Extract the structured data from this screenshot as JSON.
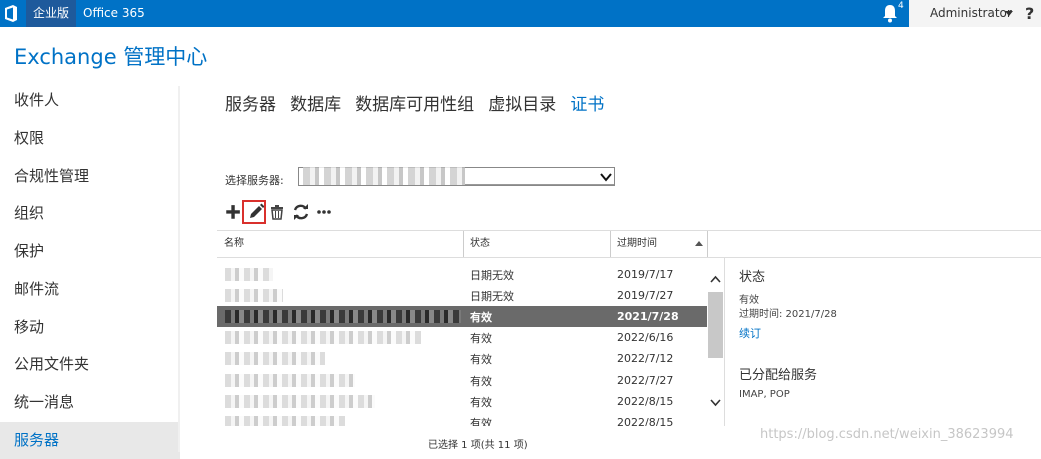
{
  "topbar": {
    "edition_label": "企业版",
    "product_label": "Office 365",
    "notification_count": "4",
    "user": "Administrator",
    "help": "?"
  },
  "app_title": "Exchange 管理中心",
  "sidebar": {
    "items": [
      {
        "label": "收件人"
      },
      {
        "label": "权限"
      },
      {
        "label": "合规性管理"
      },
      {
        "label": "组织"
      },
      {
        "label": "保护"
      },
      {
        "label": "邮件流"
      },
      {
        "label": "移动"
      },
      {
        "label": "公用文件夹"
      },
      {
        "label": "统一消息"
      },
      {
        "label": "服务器",
        "selected": true
      }
    ]
  },
  "tabs": [
    {
      "label": "服务器"
    },
    {
      "label": "数据库"
    },
    {
      "label": "数据库可用性组"
    },
    {
      "label": "虚拟目录"
    },
    {
      "label": "证书",
      "active": true
    }
  ],
  "server_select": {
    "label": "选择服务器:"
  },
  "toolbar": {
    "icons": [
      "add-icon",
      "edit-icon",
      "delete-icon",
      "refresh-icon",
      "more-icon"
    ]
  },
  "grid": {
    "columns": [
      "名称",
      "状态",
      "过期时间"
    ],
    "sorted_column": "过期时间",
    "rows": [
      {
        "status": "日期无效",
        "expires": "2019/7/17"
      },
      {
        "status": "日期无效",
        "expires": "2019/7/27"
      },
      {
        "status": "有效",
        "expires": "2021/7/28",
        "selected": true
      },
      {
        "status": "有效",
        "expires": "2022/6/16"
      },
      {
        "status": "有效",
        "expires": "2022/7/12"
      },
      {
        "status": "有效",
        "expires": "2022/7/27"
      },
      {
        "status": "有效",
        "expires": "2022/8/15"
      },
      {
        "status": "有效",
        "expires": "2022/8/15"
      }
    ]
  },
  "details": {
    "status_heading": "状态",
    "status_value": "有效",
    "expires_text": "过期时间: 2021/7/28",
    "renew_link": "续订",
    "services_heading": "已分配给服务",
    "services_value": "IMAP, POP"
  },
  "status_bar": "已选择 1 项(共 11 项)",
  "watermark": "https://blog.csdn.net/weixin_38623994",
  "colors": {
    "brand": "#0072c6",
    "selected_row": "#6a6a6a",
    "highlight_box": "#d9302c"
  }
}
